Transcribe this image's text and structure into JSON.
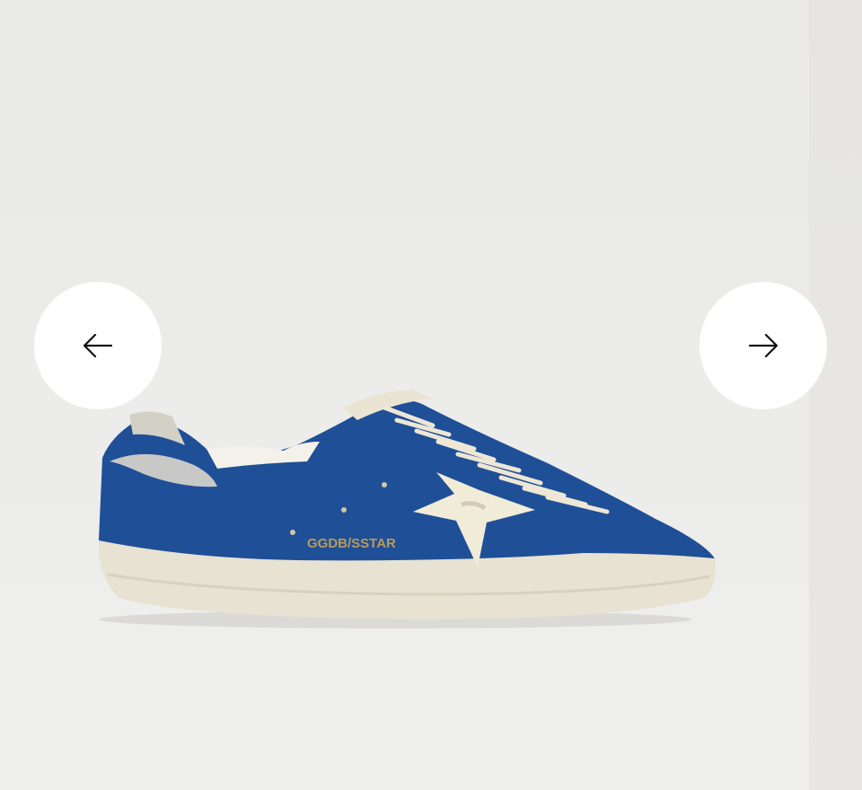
{
  "carousel": {
    "product_image": {
      "icon": "sneaker-image",
      "heel_tab_text": "GGDB/SSTAR",
      "colors": {
        "suede": "#1f4f97",
        "star": "#f1ecd8",
        "sole": "#e5e0cf",
        "heel": "#c9c9c7"
      }
    },
    "prev_button": {
      "icon": "arrow-left-icon"
    },
    "next_button": {
      "icon": "arrow-right-icon"
    }
  }
}
